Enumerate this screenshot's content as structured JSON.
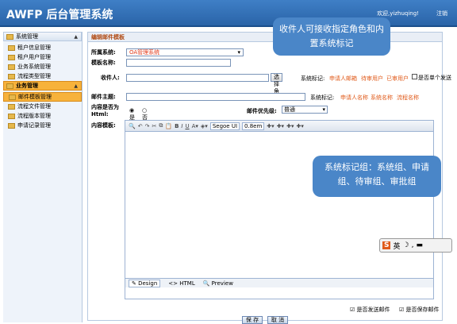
{
  "header": {
    "title": "AWFP 后台管理系统",
    "welcome": "欢迎,yizhuqing!",
    "logout": "注销"
  },
  "sidebar": {
    "groups": [
      {
        "label": "系统管理",
        "items": [
          "租户信息管理",
          "租户用户管理",
          "业务系统管理",
          "流程类型管理"
        ]
      },
      {
        "label": "业务管理",
        "items": [
          "邮件模板管理",
          "流程文件管理",
          "流程版本管理",
          "申请记录管理"
        ]
      }
    ],
    "selected": "邮件模板管理"
  },
  "main": {
    "title": "编辑邮件模板",
    "system_label": "所属系统:",
    "system_value": "OA管理系统",
    "template_name_label": "模板名称:",
    "recipient_label": "收件人:",
    "add_button": "选择角色",
    "mark_label": "系统标记:",
    "recipient_tags": [
      "申请人邮箱",
      "待审用户",
      "已审用户"
    ],
    "multi_send_label": "是否单个发送",
    "subject_label": "邮件主题:",
    "subject_mark_label": "系统标记:",
    "subject_tags": [
      "申请人名称",
      "系统名称",
      "流程名称"
    ],
    "html_label": "内容是否为Html:",
    "html_yes": "是",
    "html_no": "否",
    "priority_label": "邮件优先级:",
    "priority_value": "普通",
    "content_label": "内容模板:",
    "font": "Segoe UI",
    "size": "0.8em",
    "tabs": [
      "Design",
      "HTML",
      "Preview"
    ]
  },
  "footer": {
    "send_label": "是否发送邮件",
    "save_label": "是否保存邮件",
    "save_button": "保 存",
    "cancel_button": "取 消"
  },
  "callouts": {
    "recipient": "收件人可接收指定角色和内置系统标记",
    "groups": "系统标记组：系统组、申请组、待审组、审批组"
  },
  "ime": {
    "mode": "英"
  }
}
